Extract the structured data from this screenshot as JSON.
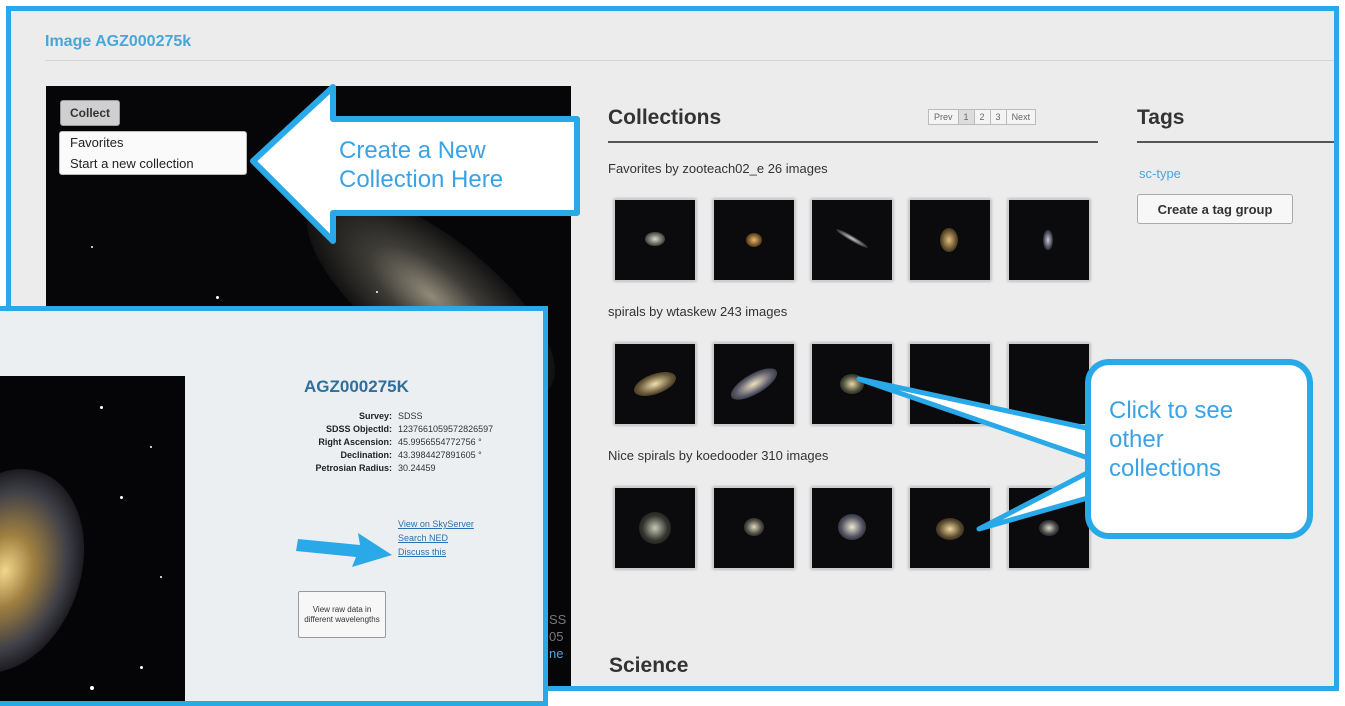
{
  "page": {
    "title": "Image AGZ000275k"
  },
  "image_panel": {
    "collect_label": "Collect",
    "collect_menu": [
      "Favorites",
      "Start a new collection"
    ],
    "caption_fragments": [
      "SS",
      "05",
      "ne"
    ]
  },
  "collections": {
    "heading": "Collections",
    "pager": [
      "Prev",
      "1",
      "2",
      "3",
      "Next"
    ],
    "groups": [
      {
        "title": "Favorites by zooteach02_e 26 images"
      },
      {
        "title": "spirals by wtaskew 243 images"
      },
      {
        "title": "Nice spirals by koedooder 310 images"
      }
    ]
  },
  "tags": {
    "heading": "Tags",
    "tag_link": "sc-type",
    "create_button": "Create a tag group"
  },
  "science": {
    "heading": "Science"
  },
  "callouts": {
    "new_collection": [
      "Create a New",
      "Collection Here"
    ],
    "see_collections": [
      "Click to see",
      "other",
      "collections"
    ]
  },
  "detail": {
    "title": "AGZ000275K",
    "fields": [
      {
        "key": "Survey:",
        "value": "SDSS"
      },
      {
        "key": "SDSS ObjectId:",
        "value": "1237661059572826597"
      },
      {
        "key": "Right Ascension:",
        "value": "45.9956554772756 °"
      },
      {
        "key": "Declination:",
        "value": "43.3984427891605 °"
      },
      {
        "key": "Petrosian Radius:",
        "value": "30.24459"
      }
    ],
    "links": [
      "View on SkyServer",
      "Search NED",
      "Discuss this"
    ],
    "raw_button": "View raw data in different wavelengths"
  },
  "colors": {
    "accent": "#2aa9e8",
    "link": "#49a6d8",
    "detail_bg": "#ebeff2"
  }
}
